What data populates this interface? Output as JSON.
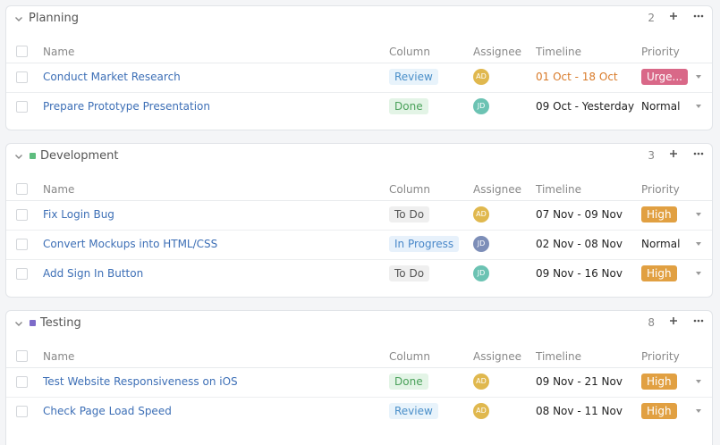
{
  "colors": {
    "assignee_ad": "#e0b84e",
    "assignee_jd_teal": "#6cc3b3",
    "assignee_jd_slate": "#7d8eb8",
    "priority_urgent": "#d96888",
    "priority_high": "#e1a042",
    "dev_accent": "#5ebd7f",
    "test_accent": "#7d6bc9"
  },
  "columns": {
    "name": "Name",
    "column": "Column",
    "assignee": "Assignee",
    "timeline": "Timeline",
    "priority": "Priority"
  },
  "groups": [
    {
      "title": "Planning",
      "count": "2",
      "rows": [
        {
          "name": "Conduct Market Research",
          "column": "Review",
          "assignee": "AD",
          "timeline": "01 Oct - 18 Oct",
          "priority": "Urge..."
        },
        {
          "name": "Prepare Prototype Presentation",
          "column": "Done",
          "assignee": "JD",
          "timeline": "09 Oct - Yesterday",
          "priority": "Normal"
        }
      ]
    },
    {
      "title": "Development",
      "count": "3",
      "rows": [
        {
          "name": "Fix Login Bug",
          "column": "To Do",
          "assignee": "AD",
          "timeline": "07 Nov - 09 Nov",
          "priority": "High"
        },
        {
          "name": "Convert Mockups into HTML/CSS",
          "column": "In Progress",
          "assignee": "JD",
          "timeline": "02 Nov - 08 Nov",
          "priority": "Normal"
        },
        {
          "name": "Add Sign In Button",
          "column": "To Do",
          "assignee": "JD",
          "timeline": "09 Nov - 16 Nov",
          "priority": "High"
        }
      ]
    },
    {
      "title": "Testing",
      "count": "8",
      "rows": [
        {
          "name": "Test Website Responsiveness on iOS",
          "column": "Done",
          "assignee": "AD",
          "timeline": "09 Nov - 21 Nov",
          "priority": "High"
        },
        {
          "name": "Check Page Load Speed",
          "column": "Review",
          "assignee": "AD",
          "timeline": "08 Nov - 11 Nov",
          "priority": "High"
        }
      ]
    }
  ]
}
